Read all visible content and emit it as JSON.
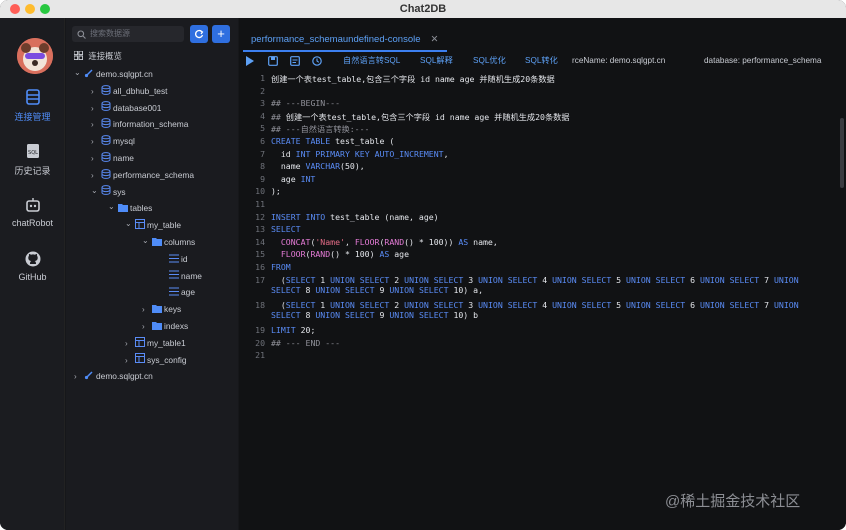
{
  "window": {
    "title": "Chat2DB"
  },
  "activity_bar": {
    "items": [
      {
        "label": "连接管理",
        "icon": "database-icon",
        "active": true
      },
      {
        "label": "历史记录",
        "icon": "sql-history-icon",
        "active": false
      },
      {
        "label": "chatRobot",
        "icon": "robot-icon",
        "active": false
      },
      {
        "label": "GitHub",
        "icon": "github-icon",
        "active": false
      }
    ]
  },
  "sidebar": {
    "search_placeholder": "搜索数据源",
    "overview_label": "连接概览",
    "tree": [
      {
        "label": "demo.sqlgpt.cn",
        "icon": "connection-icon",
        "expanded": true
      },
      {
        "label": "all_dbhub_test",
        "icon": "database-icon"
      },
      {
        "label": "database001",
        "icon": "database-icon"
      },
      {
        "label": "information_schema",
        "icon": "database-icon"
      },
      {
        "label": "mysql",
        "icon": "database-icon"
      },
      {
        "label": "name",
        "icon": "database-icon"
      },
      {
        "label": "performance_schema",
        "icon": "database-icon"
      },
      {
        "label": "sys",
        "icon": "database-icon",
        "expanded": true
      },
      {
        "label": "tables",
        "icon": "folder-icon",
        "expanded": true
      },
      {
        "label": "my_table",
        "icon": "table-icon",
        "expanded": true
      },
      {
        "label": "columns",
        "icon": "folder-icon",
        "expanded": true
      },
      {
        "label": "id",
        "icon": "column-icon"
      },
      {
        "label": "name",
        "icon": "column-icon"
      },
      {
        "label": "age",
        "icon": "column-icon"
      },
      {
        "label": "keys",
        "icon": "folder-icon"
      },
      {
        "label": "indexs",
        "icon": "folder-icon"
      },
      {
        "label": "my_table1",
        "icon": "table-icon"
      },
      {
        "label": "sys_config",
        "icon": "table-icon"
      },
      {
        "label": "demo.sqlgpt.cn",
        "icon": "connection-icon"
      }
    ]
  },
  "editor_tab": {
    "label": "performance_schemaundefined-console"
  },
  "toolbar": {
    "nl_to_sql": "自然语言转SQL",
    "sql_explain": "SQL解释",
    "sql_optimize": "SQL优化",
    "sql_convert": "SQL转化",
    "source_name": "rceName: demo.sqlgpt.cn",
    "database": "database: performance_schema"
  },
  "code_lines": [
    "创建一个表test_table,包含三个字段 id name age 并随机生成20条数据",
    "",
    "## ---BEGIN---",
    "## 创建一个表test_table,包含三个字段 id name age 并随机生成20条数据",
    "## ---自然语言转换:---",
    "CREATE TABLE test_table (",
    "  id INT PRIMARY KEY AUTO_INCREMENT,",
    "  name VARCHAR(50),",
    "  age INT",
    ");",
    "",
    "INSERT INTO test_table (name, age)",
    "SELECT",
    "  CONCAT('Name', FLOOR(RAND() * 100)) AS name,",
    "  FLOOR(RAND() * 100) AS age",
    "FROM",
    "  (SELECT 1 UNION SELECT 2 UNION SELECT 3 UNION SELECT 4 UNION SELECT 5 UNION SELECT 6 UNION SELECT 7 UNION\nSELECT 8 UNION SELECT 9 UNION SELECT 10) a,",
    "  (SELECT 1 UNION SELECT 2 UNION SELECT 3 UNION SELECT 4 UNION SELECT 5 UNION SELECT 6 UNION SELECT 7 UNION\nSELECT 8 UNION SELECT 9 UNION SELECT 10) b",
    "LIMIT 20;",
    "## --- END ---",
    ""
  ],
  "watermark": "@稀土掘金技术社区",
  "colors": {
    "accent": "#3c7ff0",
    "keyword": "#5a8cf6",
    "string": "#e36b86",
    "function": "#e47bd6"
  }
}
